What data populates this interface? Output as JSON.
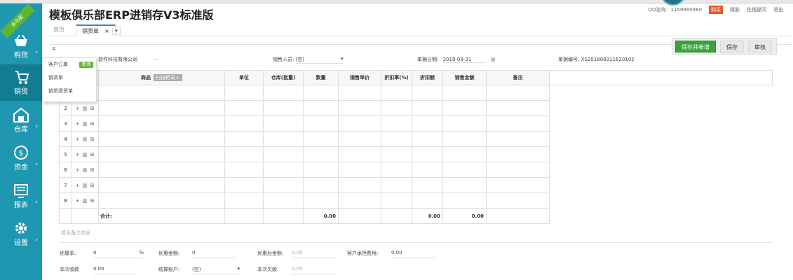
{
  "header": {
    "title": "模板俱乐部ERP进销存V3标准版",
    "qq": "QQ咨询：1159995880",
    "buy": "购买",
    "links": [
      "换肤",
      "在线提问",
      "退出"
    ]
  },
  "sidebar": {
    "ribbon": "多仓版",
    "items": [
      {
        "label": "购货",
        "icon": "basket-icon"
      },
      {
        "label": "销货",
        "icon": "cart-icon"
      },
      {
        "label": "仓库",
        "icon": "warehouse-icon"
      },
      {
        "label": "资金",
        "icon": "money-icon"
      },
      {
        "label": "报表",
        "icon": "report-icon"
      },
      {
        "label": "设置",
        "icon": "gear-icon"
      }
    ]
  },
  "dropdown": {
    "items": [
      "客户订单",
      "销货单",
      "销货退货单"
    ],
    "badge": "查询"
  },
  "tabs": {
    "home": "首页",
    "active": "销货单",
    "close": "×",
    "more": "▾"
  },
  "form": {
    "customer": "软件科技有限公司",
    "customer_more": "···",
    "salesman_label": "销售人员:",
    "salesman_value": "(空)",
    "date_label": "单据日期:",
    "date_value": "2018-08-31",
    "no_label": "单据编号:",
    "no_value": "XS201808311620102"
  },
  "buttons": {
    "save_new": "保存并新增",
    "save": "保存",
    "audit": "审核"
  },
  "table": {
    "headers": [
      "",
      "",
      "商品",
      "单位",
      "仓库(批量)",
      "数量",
      "销售单价",
      "折扣率(%)",
      "折扣额",
      "销售金额",
      "备注"
    ],
    "scan_tag": "扫描枪录入",
    "rows": [
      "1",
      "2",
      "3",
      "4",
      "5",
      "6",
      "7",
      "8"
    ],
    "ops": "+ ▥ ⊞",
    "total_label": "合计:",
    "total_qty": "0.00",
    "total_discount": "0.00",
    "total_amount": "0.00"
  },
  "bottom": {
    "remark_placeholder": "暂无备注信息",
    "discount_rate_label": "优惠率:",
    "discount_rate_value": "0",
    "percent": "%",
    "discount_amt_label": "优惠金额:",
    "discount_amt_value": "0",
    "after_discount_label": "优惠后金额:",
    "after_discount_value": "0.00",
    "customer_fee_label": "客户承担费用:",
    "customer_fee_value": "0.00",
    "received_label": "本次收款",
    "received_value": "0.00",
    "account_label": "结算账户:",
    "account_value": "(空)",
    "owed_label": "本次欠款:",
    "owed_value": "0.00"
  }
}
